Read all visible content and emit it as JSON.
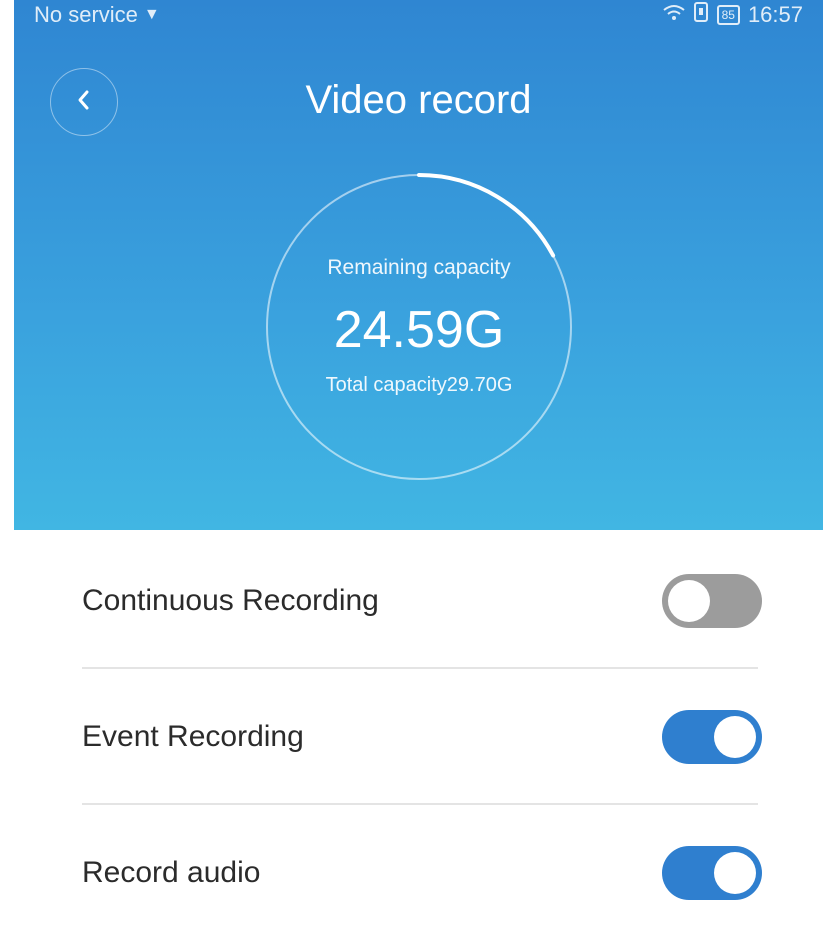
{
  "status_bar": {
    "carrier": "No service",
    "battery": "85",
    "time": "16:57"
  },
  "header": {
    "title": "Video record"
  },
  "storage": {
    "remaining_label": "Remaining capacity",
    "remaining_value": "24.59G",
    "total_label": "Total capacity29.70G",
    "used_fraction": 0.172
  },
  "settings": [
    {
      "label": "Continuous Recording",
      "enabled": false
    },
    {
      "label": "Event Recording",
      "enabled": true
    },
    {
      "label": "Record audio",
      "enabled": true
    }
  ],
  "colors": {
    "header_top": "#2f86d2",
    "header_bottom": "#41b6e3",
    "toggle_on": "#2f7fcf",
    "toggle_off": "#9c9c9c"
  }
}
